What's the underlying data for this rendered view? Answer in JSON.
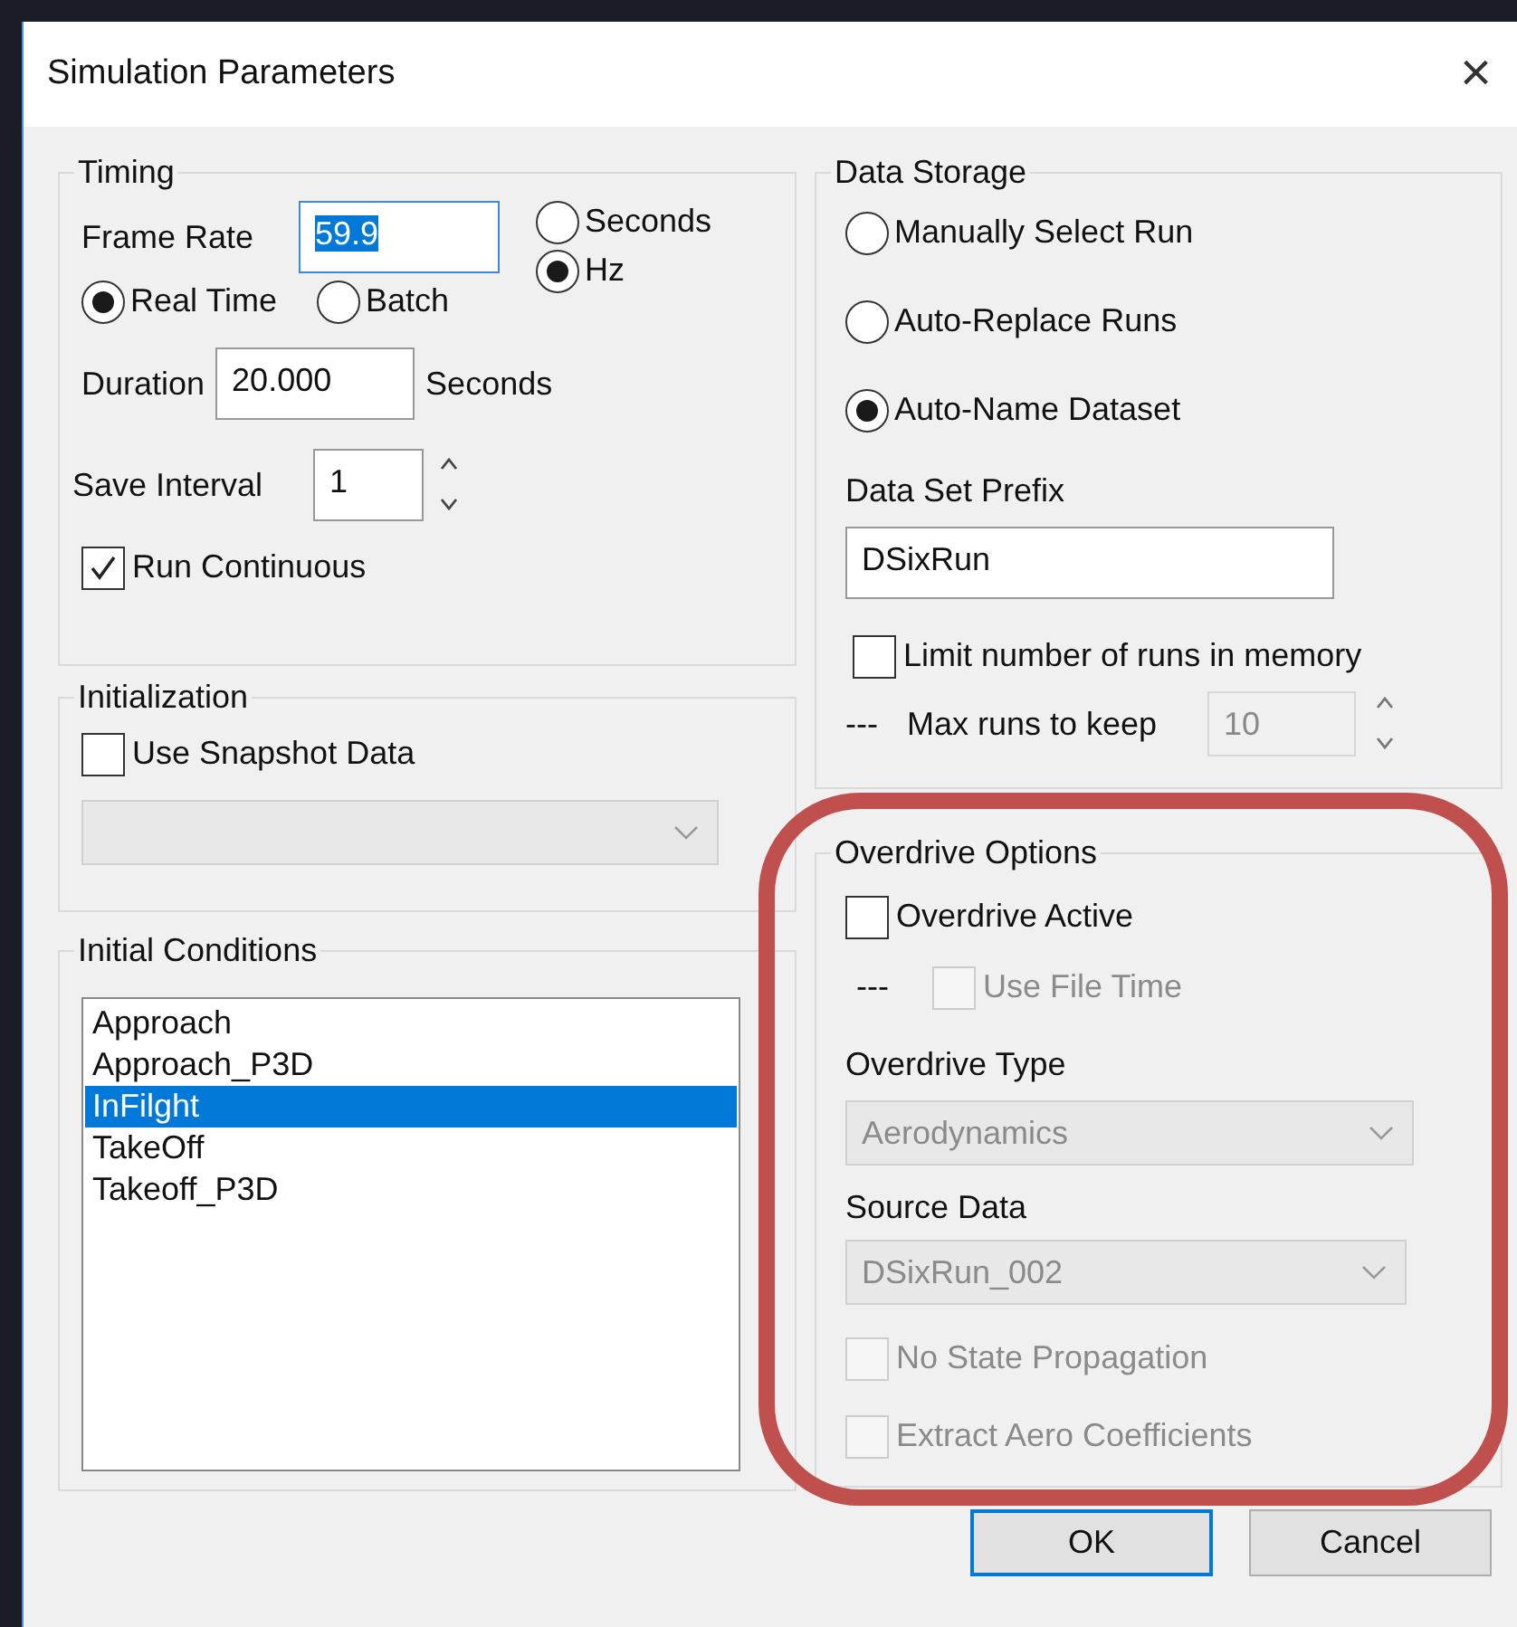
{
  "window": {
    "title": "Simulation Parameters",
    "close": "×"
  },
  "timing": {
    "title": "Timing",
    "frame_rate": {
      "label": "Frame Rate",
      "value": "59.9",
      "text_selected": true
    },
    "units": [
      {
        "label": "Seconds",
        "selected": false
      },
      {
        "label": "Hz",
        "selected": true
      }
    ],
    "modes": [
      {
        "label": "Real Time",
        "selected": true
      },
      {
        "label": "Batch",
        "selected": false
      }
    ],
    "duration": {
      "label": "Duration",
      "value": "20.000",
      "unit": "Seconds"
    },
    "save_interval": {
      "label": "Save Interval",
      "value": "1"
    },
    "run_continuous": {
      "label": "Run Continuous",
      "checked": true
    }
  },
  "initialization": {
    "title": "Initialization",
    "use_snapshot": {
      "label": "Use Snapshot Data",
      "checked": false
    },
    "snapshot_dropdown": {
      "disabled": true
    }
  },
  "initial_conditions": {
    "title": "Initial Conditions",
    "items": [
      {
        "label": "Approach",
        "selected": false
      },
      {
        "label": "Approach_P3D",
        "selected": false
      },
      {
        "label": "InFilght",
        "selected": true
      },
      {
        "label": "TakeOff",
        "selected": false
      },
      {
        "label": "Takeoff_P3D",
        "selected": false
      }
    ]
  },
  "data_storage": {
    "title": "Data Storage",
    "options": [
      {
        "label": "Manually Select Run",
        "selected": false
      },
      {
        "label": "Auto-Replace Runs",
        "selected": false
      },
      {
        "label": "Auto-Name Dataset",
        "selected": true
      }
    ],
    "prefix": {
      "label": "Data Set Prefix",
      "value": "DSixRun"
    },
    "limit_runs": {
      "label": "Limit number of runs in memory",
      "checked": false
    },
    "max_runs": {
      "prefix": "---",
      "label": "Max runs to keep",
      "value": "10",
      "disabled": true
    }
  },
  "overdrive": {
    "title": "Overdrive Options",
    "active": {
      "label": "Overdrive Active",
      "checked": false,
      "disabled": false
    },
    "use_file_time": {
      "prefix": "---",
      "label": "Use File Time",
      "checked": false,
      "disabled": true
    },
    "type": {
      "label": "Overdrive Type",
      "value": "Aerodynamics",
      "disabled": true
    },
    "source": {
      "label": "Source Data",
      "value": "DSixRun_002",
      "disabled": true
    },
    "no_state": {
      "label": "No State Propagation",
      "checked": false,
      "disabled": true
    },
    "extract": {
      "label": "Extract Aero Coefficients",
      "checked": false,
      "disabled": true
    }
  },
  "buttons": [
    {
      "label": "OK",
      "default": true
    },
    {
      "label": "Cancel",
      "default": false
    }
  ],
  "annotation": {
    "kind": "highlight",
    "color": "#c0504d"
  }
}
